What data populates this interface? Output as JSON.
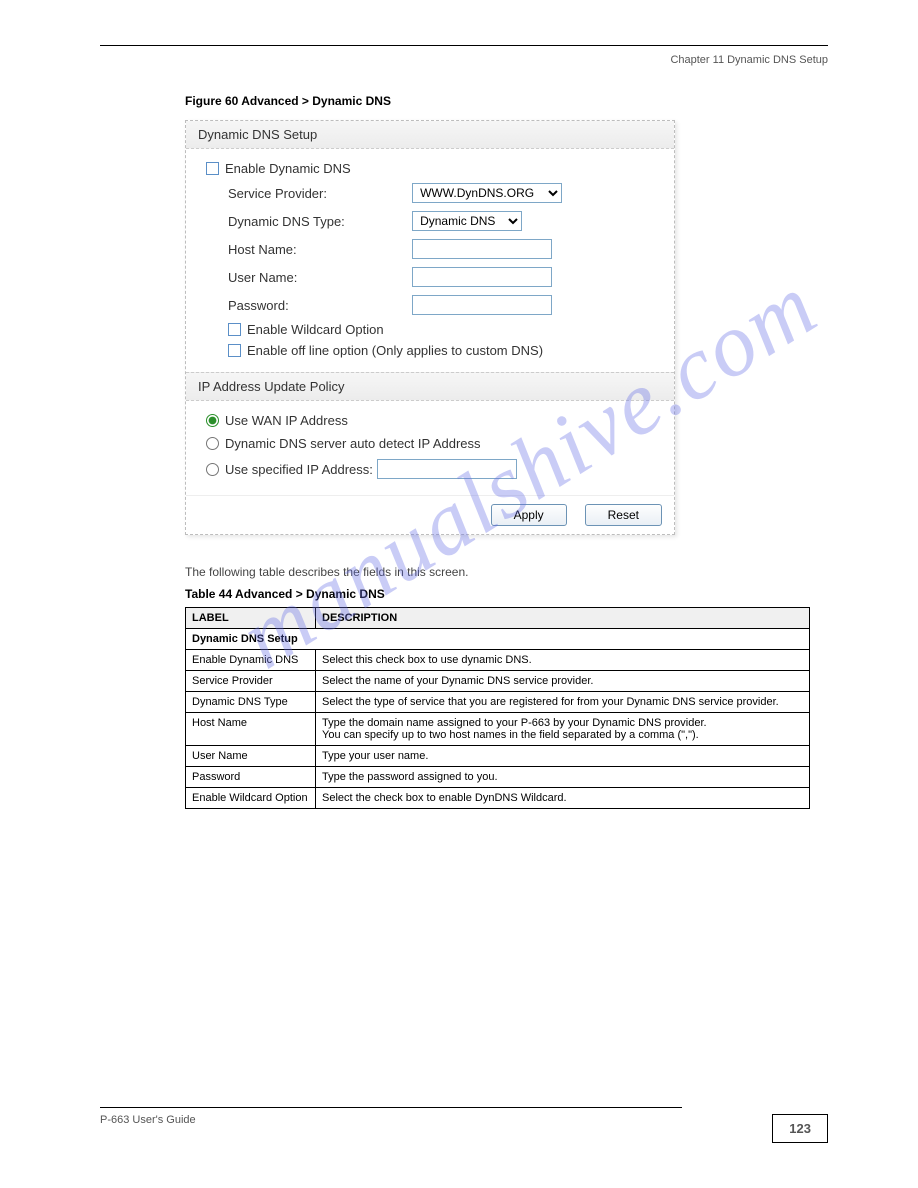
{
  "header_right": "Chapter 11 Dynamic DNS Setup",
  "figure_caption": "Figure 60   Advanced > Dynamic DNS",
  "panel1": {
    "title": "Dynamic DNS Setup",
    "enable_label": "Enable Dynamic DNS",
    "rows": {
      "service_provider": {
        "label": "Service Provider:",
        "value": "WWW.DynDNS.ORG"
      },
      "dns_type": {
        "label": "Dynamic DNS Type:",
        "value": "Dynamic DNS"
      },
      "host_name": {
        "label": "Host Name:",
        "value": ""
      },
      "user_name": {
        "label": "User Name:",
        "value": ""
      },
      "password": {
        "label": "Password:",
        "value": ""
      }
    },
    "wildcard_label": "Enable Wildcard Option",
    "offline_label": "Enable off line option (Only applies to custom DNS)"
  },
  "panel2": {
    "title": "IP Address Update Policy",
    "opt_wan": "Use WAN IP Address",
    "opt_auto": "Dynamic DNS server auto detect IP Address",
    "opt_spec": "Use specified IP Address:",
    "spec_value": ""
  },
  "buttons": {
    "apply": "Apply",
    "reset": "Reset"
  },
  "intro_text": "The following table describes the fields in this screen.",
  "table_caption": "Table 44   Advanced > Dynamic DNS",
  "table": {
    "headers": [
      "LABEL",
      "DESCRIPTION"
    ],
    "rows": [
      {
        "label": "Dynamic DNS Setup",
        "desc": "",
        "span": true
      },
      {
        "label": "Enable Dynamic DNS",
        "desc": "Select this check box to use dynamic DNS."
      },
      {
        "label": "Service Provider",
        "desc": "Select the name of your Dynamic DNS service provider."
      },
      {
        "label": "Dynamic DNS Type",
        "desc": "Select the type of service that you are registered for from your Dynamic DNS service provider."
      },
      {
        "label": "Host Name",
        "desc": "Type the domain name assigned to your P-663 by your Dynamic DNS provider.\nYou can specify up to two host names in the field separated by a comma (\",\")."
      },
      {
        "label": "User Name",
        "desc": "Type your user name."
      },
      {
        "label": "Password",
        "desc": "Type the password assigned to you."
      },
      {
        "label": "Enable Wildcard Option",
        "desc": "Select the check box to enable DynDNS Wildcard."
      }
    ]
  },
  "footer_text": "P-663 User's Guide",
  "page_number": "123",
  "watermark": "manualshive.com"
}
